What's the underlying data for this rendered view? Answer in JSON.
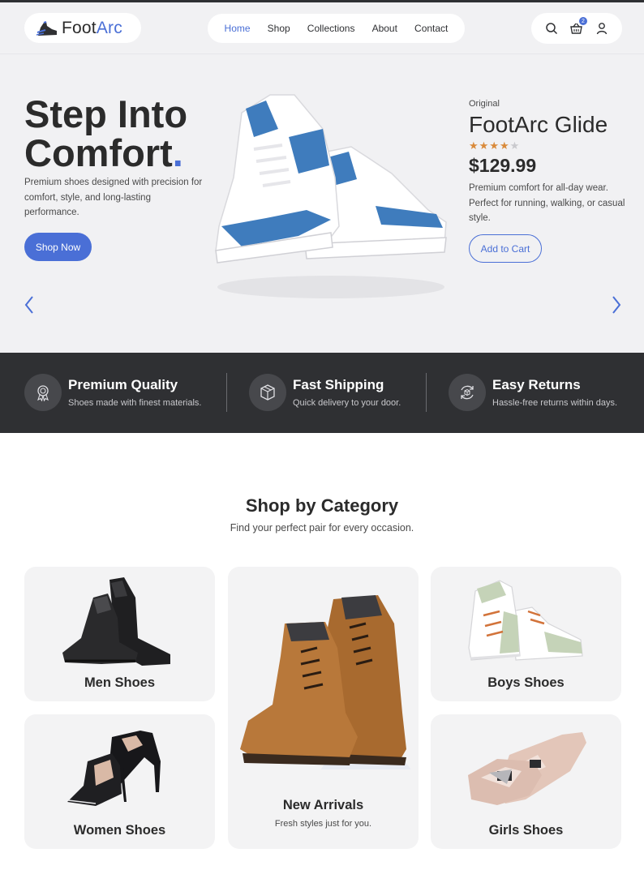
{
  "brand": {
    "name_part1": "Foot",
    "name_part2": "Arc",
    "accent": "#4a6fd6",
    "dark": "#2f3033"
  },
  "nav": {
    "items": [
      "Home",
      "Shop",
      "Collections",
      "About",
      "Contact"
    ],
    "active": "Home"
  },
  "header_icons": {
    "search": "search-icon",
    "cart": "cart-icon",
    "account": "user-icon",
    "cart_count": "2"
  },
  "hero": {
    "title_line1": "Step Into",
    "title_line2": "Comfort",
    "title_dot": ".",
    "description": "Premium shoes designed with precision for comfort, style, and long-lasting performance.",
    "cta": "Shop Now",
    "product": {
      "tag": "Original",
      "name": "FootArc Glide",
      "rating": 4,
      "rating_max": 5,
      "price": "$129.99",
      "description": "Premium comfort for all-day wear. Perfect for running, walking, or casual style.",
      "button": "Add to Cart"
    }
  },
  "features": [
    {
      "icon": "badge-icon",
      "title": "Premium Quality",
      "subtitle": "Shoes made with finest materials."
    },
    {
      "icon": "box-icon",
      "title": "Fast Shipping",
      "subtitle": "Quick delivery to your door."
    },
    {
      "icon": "returns-icon",
      "title": "Easy Returns",
      "subtitle": "Hassle-free returns within days."
    }
  ],
  "category": {
    "title": "Shop by Category",
    "subtitle": "Find your perfect pair for every occasion.",
    "cards": {
      "men": {
        "label": "Men Shoes"
      },
      "women": {
        "label": "Women Shoes"
      },
      "new": {
        "label": "New Arrivals",
        "subtitle": "Fresh styles just for you."
      },
      "boys": {
        "label": "Boys Shoes"
      },
      "girls": {
        "label": "Girls Shoes"
      }
    }
  }
}
